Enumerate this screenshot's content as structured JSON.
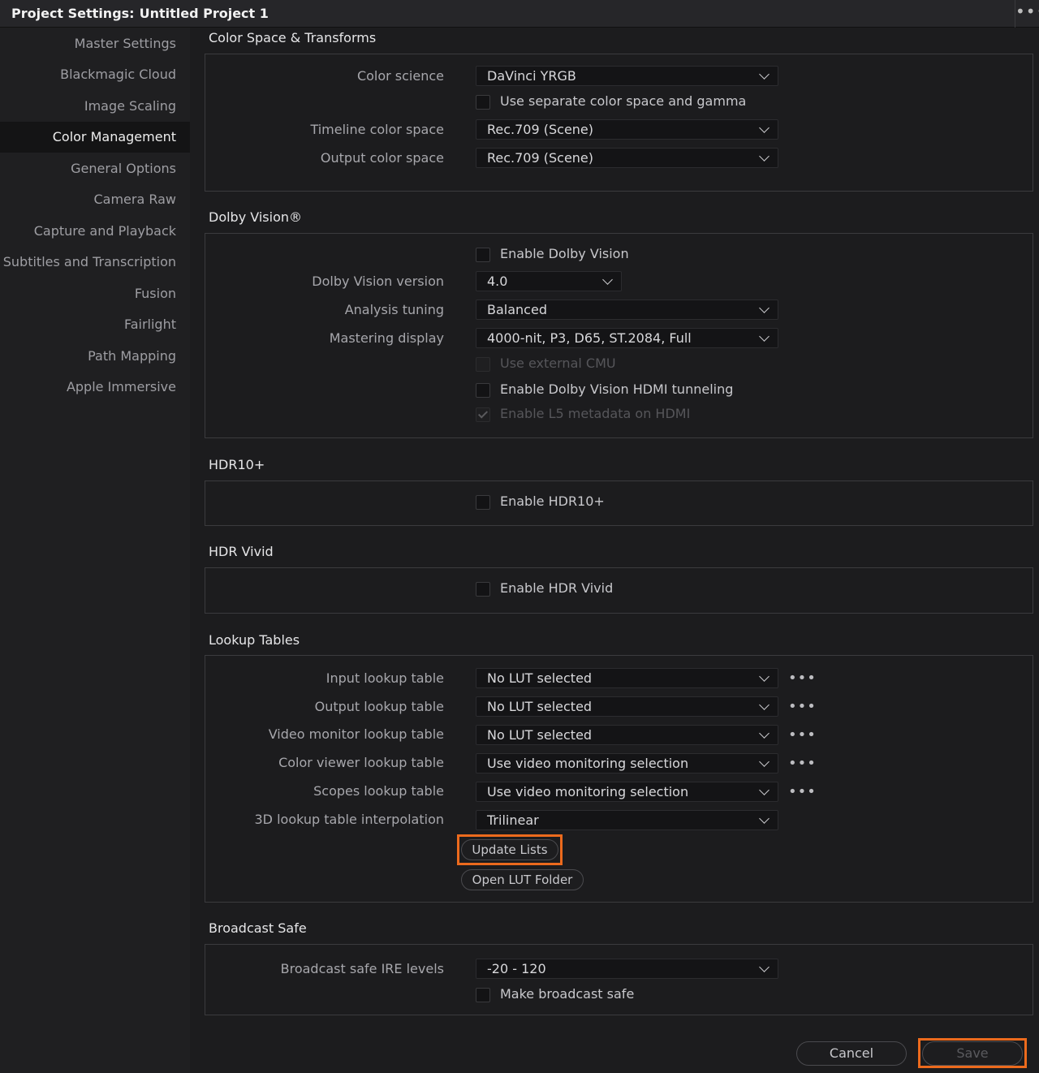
{
  "window": {
    "title_prefix": "Project Settings:",
    "project_name": "Untitled Project 1",
    "menu_icon": "more-dots-icon"
  },
  "sidebar": {
    "items": [
      {
        "label": "Master Settings"
      },
      {
        "label": "Blackmagic Cloud"
      },
      {
        "label": "Image Scaling"
      },
      {
        "label": "Color Management",
        "active": true
      },
      {
        "label": "General Options"
      },
      {
        "label": "Camera Raw"
      },
      {
        "label": "Capture and Playback"
      },
      {
        "label": "Subtitles and Transcription"
      },
      {
        "label": "Fusion"
      },
      {
        "label": "Fairlight"
      },
      {
        "label": "Path Mapping"
      },
      {
        "label": "Apple Immersive"
      }
    ]
  },
  "color_space": {
    "title": "Color Space & Transforms",
    "color_science_label": "Color science",
    "color_science_value": "DaVinci YRGB",
    "separate_label": "Use separate color space and gamma",
    "timeline_label": "Timeline color space",
    "timeline_value": "Rec.709 (Scene)",
    "output_label": "Output color space",
    "output_value": "Rec.709 (Scene)"
  },
  "dolby": {
    "title": "Dolby Vision®",
    "enable_label": "Enable Dolby Vision",
    "version_label": "Dolby Vision version",
    "version_value": "4.0",
    "tuning_label": "Analysis tuning",
    "tuning_value": "Balanced",
    "mastering_label": "Mastering display",
    "mastering_value": "4000-nit, P3, D65, ST.2084, Full",
    "cmu_label": "Use external CMU",
    "hdmi_label": "Enable Dolby Vision HDMI tunneling",
    "l5_label": "Enable L5 metadata on HDMI"
  },
  "hdr10": {
    "title": "HDR10+",
    "enable_label": "Enable HDR10+"
  },
  "hdrvivid": {
    "title": "HDR Vivid",
    "enable_label": "Enable HDR Vivid"
  },
  "luts": {
    "title": "Lookup Tables",
    "rows": [
      {
        "label": "Input lookup table",
        "value": "No LUT selected"
      },
      {
        "label": "Output lookup table",
        "value": "No LUT selected"
      },
      {
        "label": "Video monitor lookup table",
        "value": "No LUT selected"
      },
      {
        "label": "Color viewer lookup table",
        "value": "Use video monitoring selection"
      },
      {
        "label": "Scopes lookup table",
        "value": "Use video monitoring selection"
      },
      {
        "label": "3D lookup table interpolation",
        "value": "Trilinear"
      }
    ],
    "more_glyph": "•••",
    "update_label": "Update Lists",
    "open_folder_label": "Open LUT Folder"
  },
  "broadcast": {
    "title": "Broadcast Safe",
    "ire_label": "Broadcast safe IRE levels",
    "ire_value": "-20 - 120",
    "make_safe_label": "Make broadcast safe"
  },
  "footer": {
    "cancel_label": "Cancel",
    "save_label": "Save"
  },
  "colors": {
    "highlight": "#ec6a1d",
    "background": "#1c1c1e",
    "sidebar_active": "#141415"
  }
}
